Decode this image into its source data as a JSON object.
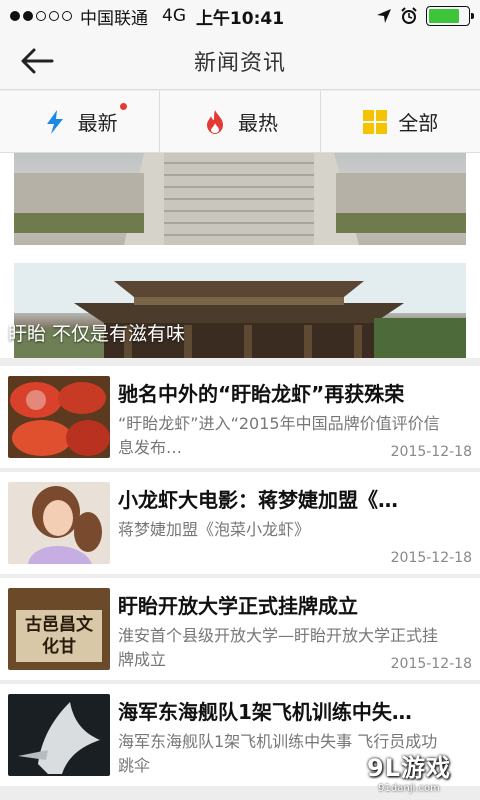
{
  "status_bar": {
    "carrier": "中国联通",
    "network": "4G",
    "time": "上午10:41",
    "battery_level": 0.8
  },
  "navbar": {
    "title": "新闻资讯"
  },
  "tabs": [
    {
      "label": "最新",
      "icon": "lightning-icon",
      "badge": true
    },
    {
      "label": "最热",
      "icon": "flame-icon",
      "badge": false
    },
    {
      "label": "全部",
      "icon": "grid-icon",
      "badge": false
    }
  ],
  "banner": {
    "caption": "盱眙 不仅是有滋有味"
  },
  "news": [
    {
      "title": "驰名中外的“盱眙龙虾”再获殊荣",
      "summary": "“盱眙龙虾”进入“2015年中国品牌价值评价信息发布…",
      "date": "2015-12-18"
    },
    {
      "title": "小龙虾大电影：蒋梦婕加盟《…",
      "summary": "蒋梦婕加盟《泡菜小龙虾》",
      "date": "2015-12-18"
    },
    {
      "title": "盱眙开放大学正式挂牌成立",
      "summary": "淮安首个县级开放大学—盱眙开放大学正式挂牌成立",
      "date": "2015-12-18"
    },
    {
      "title": "海军东海舰队1架飞机训练中失…",
      "summary": "海军东海舰队1架飞机训练中失事 飞行员成功跳伞",
      "date": ""
    }
  ],
  "thumb_text": {
    "item3": "古邑昌文化甘"
  },
  "watermark": {
    "main": "9L游戏",
    "sub": "91danji.com"
  },
  "colors": {
    "accent_blue": "#1e88e5",
    "flame_red": "#e53935",
    "grid_yellow": "#f5c400",
    "battery_green": "#3cc63c"
  }
}
